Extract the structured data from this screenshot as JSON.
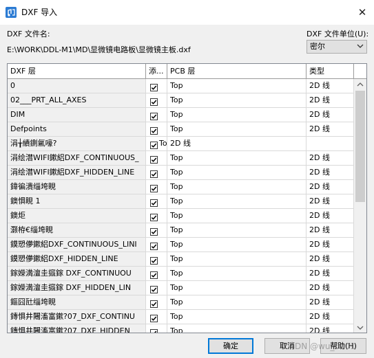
{
  "window": {
    "title": "DXF 导入",
    "close_glyph": "✕"
  },
  "file": {
    "label": "DXF 文件名:",
    "path": "E:\\WORK\\DDL-M1\\MD\\显微镜电路板\\显微镜主板.dxf"
  },
  "unit": {
    "label": "DXF 文件单位(U):",
    "value": "密尔"
  },
  "grid": {
    "headers": {
      "layer": "DXF 层",
      "add": "添...",
      "pcb": "PCB 层",
      "type": "类型"
    },
    "rows": [
      {
        "layer": "0",
        "checked": true,
        "check_text": "",
        "pcb": "Top",
        "type": "2D 线"
      },
      {
        "layer": "02___PRT_ALL_AXES",
        "checked": true,
        "check_text": "",
        "pcb": "Top",
        "type": "2D 线"
      },
      {
        "layer": "DIM",
        "checked": true,
        "check_text": "",
        "pcb": "Top",
        "type": "2D 线"
      },
      {
        "layer": "Defpoints",
        "checked": true,
        "check_text": "",
        "pcb": "Top",
        "type": "2D 线"
      },
      {
        "layer": "涓╁績鍘氱嚎?",
        "checked": true,
        "check_text": "To",
        "pcb": "2D 线",
        "type": ""
      },
      {
        "layer": "涓绘澘WIFI鏉絽DXF_CONTINUOUS_",
        "checked": true,
        "check_text": "",
        "pcb": "Top",
        "type": "2D 线"
      },
      {
        "layer": "涓绘澘WIFI鏉絽DXF_HIDDEN_LINE",
        "checked": true,
        "check_text": "",
        "pcb": "Top",
        "type": "2D 线"
      },
      {
        "layer": "鍏徧潰缁垮睍",
        "checked": true,
        "check_text": "",
        "pcb": "Top",
        "type": "2D 线"
      },
      {
        "layer": "鐭惧睍 1",
        "checked": true,
        "check_text": "",
        "pcb": "Top",
        "type": "2D 线"
      },
      {
        "layer": "鐭炬",
        "checked": true,
        "check_text": "",
        "pcb": "Top",
        "type": "2D 线"
      },
      {
        "layer": "灏栫€缁垮睍",
        "checked": true,
        "check_text": "",
        "pcb": "Top",
        "type": "2D 线"
      },
      {
        "layer": "鏌愬儚鏉絽DXF_CONTINUOUS_LINI",
        "checked": true,
        "check_text": "",
        "pcb": "Top",
        "type": "2D 线"
      },
      {
        "layer": "鏌愬儚鏉絽DXF_HIDDEN_LINE",
        "checked": true,
        "check_text": "",
        "pcb": "Top",
        "type": "2D 线"
      },
      {
        "layer": "鎵嬫満澶圭攨鎵    DXF_CONTINUOU",
        "checked": true,
        "check_text": "",
        "pcb": "Top",
        "type": "2D 线"
      },
      {
        "layer": "鎵嬫満澶圭攨鎵    DXF_HIDDEN_LIN",
        "checked": true,
        "check_text": "",
        "pcb": "Top",
        "type": "2D 线"
      },
      {
        "layer": "鏂囧瓧缁垮睍",
        "checked": true,
        "check_text": "",
        "pcb": "Top",
        "type": "2D 线"
      },
      {
        "layer": "鏄惧井闀滀富鏉?07_DXF_CONTINU",
        "checked": true,
        "check_text": "",
        "pcb": "Top",
        "type": "2D 线"
      },
      {
        "layer": "鏄惧井闀滀富鏉?07_DXF_HIDDEN_",
        "checked": true,
        "check_text": "",
        "pcb": "Top",
        "type": "2D 线"
      }
    ]
  },
  "buttons": {
    "ok": "确定",
    "cancel": "取消",
    "help": "帮助(H)"
  },
  "watermark": "CSDN @wu_0001"
}
